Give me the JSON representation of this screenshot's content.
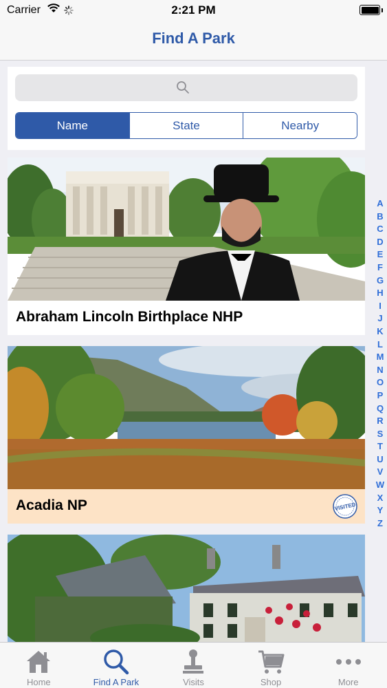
{
  "status_bar": {
    "carrier": "Carrier",
    "time": "2:21 PM"
  },
  "nav": {
    "title": "Find A Park"
  },
  "search": {
    "placeholder": ""
  },
  "segments": [
    {
      "label": "Name",
      "active": true
    },
    {
      "label": "State",
      "active": false
    },
    {
      "label": "Nearby",
      "active": false
    }
  ],
  "parks": [
    {
      "name": "Abraham Lincoln Birthplace NHP",
      "visited": false
    },
    {
      "name": "Acadia NP",
      "visited": true,
      "badge": "VISITED"
    },
    {
      "name": "",
      "visited": false
    }
  ],
  "index_letters": [
    "A",
    "B",
    "C",
    "D",
    "E",
    "F",
    "G",
    "H",
    "I",
    "J",
    "K",
    "L",
    "M",
    "N",
    "O",
    "P",
    "Q",
    "R",
    "S",
    "T",
    "U",
    "V",
    "W",
    "X",
    "Y",
    "Z"
  ],
  "tabs": [
    {
      "label": "Home",
      "icon": "home-icon",
      "active": false
    },
    {
      "label": "Find A Park",
      "icon": "search-icon",
      "active": true
    },
    {
      "label": "Visits",
      "icon": "stamp-icon",
      "active": false
    },
    {
      "label": "Shop",
      "icon": "cart-icon",
      "active": false
    },
    {
      "label": "More",
      "icon": "more-icon",
      "active": false
    }
  ],
  "colors": {
    "accent": "#2f5aa8",
    "index_blue": "#2f6ed8",
    "visited_bg": "#fde3c6",
    "background": "#efeff4"
  }
}
